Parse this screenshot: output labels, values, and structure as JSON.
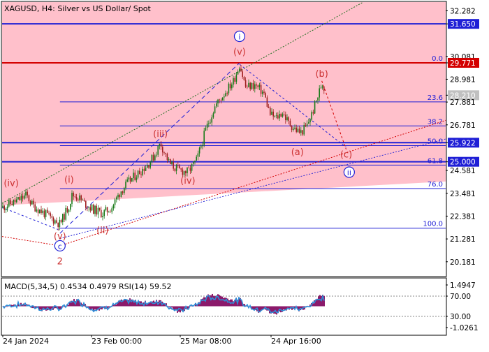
{
  "header": {
    "title": "XAGUSD, H4:  Silver vs US Dollar/ Spot"
  },
  "colors": {
    "zone_fill": "#ffc0cb",
    "blue": "#1f1fd6",
    "red_line": "#d40000",
    "wave_red": "#cc3333",
    "wave_blue": "#1f1fd6",
    "candle_up": "#1a7a1a",
    "candle_down": "#a02020",
    "macd_hist": "#8b1a6b",
    "macd_signal": "#2f8fd8",
    "current_price_box": "#c0c0c0"
  },
  "chart_data": [
    {
      "type": "candlestick",
      "symbol": "XAGUSD",
      "timeframe": "H4",
      "ylim": [
        19.5,
        32.7
      ],
      "y_ticks": [
        "32.282",
        "31.650",
        "30.081",
        "29.771",
        "28.981",
        "28.210",
        "27.881",
        "26.781",
        "25.922",
        "25.000",
        "24.581",
        "23.481",
        "22.381",
        "21.281",
        "20.181"
      ],
      "x_labels": [
        "24 Jan 2024",
        "23 Feb 00:00",
        "25 Mar 08:00",
        "24 Apr 16:00"
      ],
      "x_range": [
        "2024-01-24",
        "2024-05-09"
      ],
      "price_path": [
        [
          "2024-01-24",
          22.8
        ],
        [
          "2024-01-27",
          23.0
        ],
        [
          "2024-01-30",
          23.2
        ],
        [
          "2024-02-01",
          23.4
        ],
        [
          "2024-02-03",
          22.9
        ],
        [
          "2024-02-06",
          22.6
        ],
        [
          "2024-02-09",
          22.3
        ],
        [
          "2024-02-12",
          22.0
        ],
        [
          "2024-02-15",
          22.9
        ],
        [
          "2024-02-16",
          23.4
        ],
        [
          "2024-02-18",
          23.3
        ],
        [
          "2024-02-20",
          23.0
        ],
        [
          "2024-02-23",
          22.7
        ],
        [
          "2024-02-26",
          22.5
        ],
        [
          "2024-02-29",
          22.8
        ],
        [
          "2024-03-03",
          23.6
        ],
        [
          "2024-03-06",
          24.1
        ],
        [
          "2024-03-09",
          24.5
        ],
        [
          "2024-03-12",
          24.9
        ],
        [
          "2024-03-14",
          25.3
        ],
        [
          "2024-03-16",
          25.9
        ],
        [
          "2024-03-19",
          24.9
        ],
        [
          "2024-03-22",
          24.6
        ],
        [
          "2024-03-25",
          24.5
        ],
        [
          "2024-03-28",
          25.1
        ],
        [
          "2024-03-31",
          26.6
        ],
        [
          "2024-04-03",
          27.7
        ],
        [
          "2024-04-06",
          28.3
        ],
        [
          "2024-04-09",
          28.9
        ],
        [
          "2024-04-11",
          29.7
        ],
        [
          "2024-04-13",
          28.6
        ],
        [
          "2024-04-16",
          28.7
        ],
        [
          "2024-04-19",
          28.3
        ],
        [
          "2024-04-20",
          27.8
        ],
        [
          "2024-04-21",
          27.3
        ],
        [
          "2024-04-23",
          27.1
        ],
        [
          "2024-04-25",
          27.4
        ],
        [
          "2024-04-27",
          26.9
        ],
        [
          "2024-04-29",
          26.6
        ],
        [
          "2024-05-01",
          26.4
        ],
        [
          "2024-05-03",
          26.7
        ],
        [
          "2024-05-05",
          27.4
        ],
        [
          "2024-05-07",
          28.3
        ],
        [
          "2024-05-08",
          28.8
        ],
        [
          "2024-05-09",
          28.5
        ]
      ],
      "horizontal_levels": [
        {
          "price": 31.65,
          "label": "31.650",
          "style": "blue"
        },
        {
          "price": 29.771,
          "label": "29.771",
          "style": "red"
        },
        {
          "price": 25.922,
          "label": "25.922",
          "style": "blue"
        },
        {
          "price": 25.0,
          "label": "25.000",
          "style": "blue"
        }
      ],
      "current_price": "28.210",
      "fibonacci": {
        "start": "2024-02-12",
        "high": 29.77,
        "low": 21.8,
        "levels": [
          {
            "level": "0.0",
            "price": 29.771
          },
          {
            "level": "23.6",
            "price": 27.89
          },
          {
            "level": "38.2",
            "price": 26.73
          },
          {
            "level": "50.0",
            "price": 25.78
          },
          {
            "level": "61.8",
            "price": 24.84
          },
          {
            "level": "76.0",
            "price": 23.71
          },
          {
            "level": "100.0",
            "price": 21.8
          }
        ]
      },
      "wave_labels": [
        {
          "text": "(iv)",
          "x": "2024-01-27",
          "y": 23.98,
          "color": "red",
          "circled": false
        },
        {
          "text": "(i)",
          "x": "2024-02-15",
          "y": 24.15,
          "color": "red",
          "circled": false
        },
        {
          "text": "(v)",
          "x": "2024-02-12",
          "y": 21.42,
          "color": "red",
          "circled": false
        },
        {
          "text": "c",
          "x": "2024-02-12",
          "y": 20.95,
          "color": "blue",
          "circled": true
        },
        {
          "text": "2",
          "x": "2024-02-12",
          "y": 20.2,
          "color": "red",
          "circled": false
        },
        {
          "text": "(ii)",
          "x": "2024-02-26",
          "y": 21.7,
          "color": "red",
          "circled": false
        },
        {
          "text": "(iii)",
          "x": "2024-03-16",
          "y": 26.35,
          "color": "red",
          "circled": false
        },
        {
          "text": "(iv)",
          "x": "2024-03-25",
          "y": 24.1,
          "color": "red",
          "circled": false
        },
        {
          "text": "(v)",
          "x": "2024-04-11",
          "y": 30.31,
          "color": "red",
          "circled": false
        },
        {
          "text": "i",
          "x": "2024-04-11",
          "y": 31.05,
          "color": "blue",
          "circled": true
        },
        {
          "text": "(a)",
          "x": "2024-04-30",
          "y": 25.48,
          "color": "red",
          "circled": false
        },
        {
          "text": "(b)",
          "x": "2024-05-08",
          "y": 29.25,
          "color": "red",
          "circled": false
        },
        {
          "text": "(c)",
          "x": "2024-05-16",
          "y": 25.36,
          "color": "red",
          "circled": false
        },
        {
          "text": "ii",
          "x": "2024-05-17",
          "y": 24.5,
          "color": "blue",
          "circled": true
        }
      ]
    },
    {
      "type": "indicator",
      "title": "MACD(5,34,5) 0.4534 0.4979 RSI(14) 59.52",
      "y_ticks_upper": [
        "1.4947",
        "70.00"
      ],
      "y_ticks_lower": [
        "30.00",
        "-1.0261"
      ],
      "series": [
        {
          "name": "MACD(5,34,5)",
          "values": [
            0.4534,
            0.4979
          ]
        },
        {
          "name": "RSI(14)",
          "values": [
            59.52
          ]
        }
      ]
    }
  ]
}
